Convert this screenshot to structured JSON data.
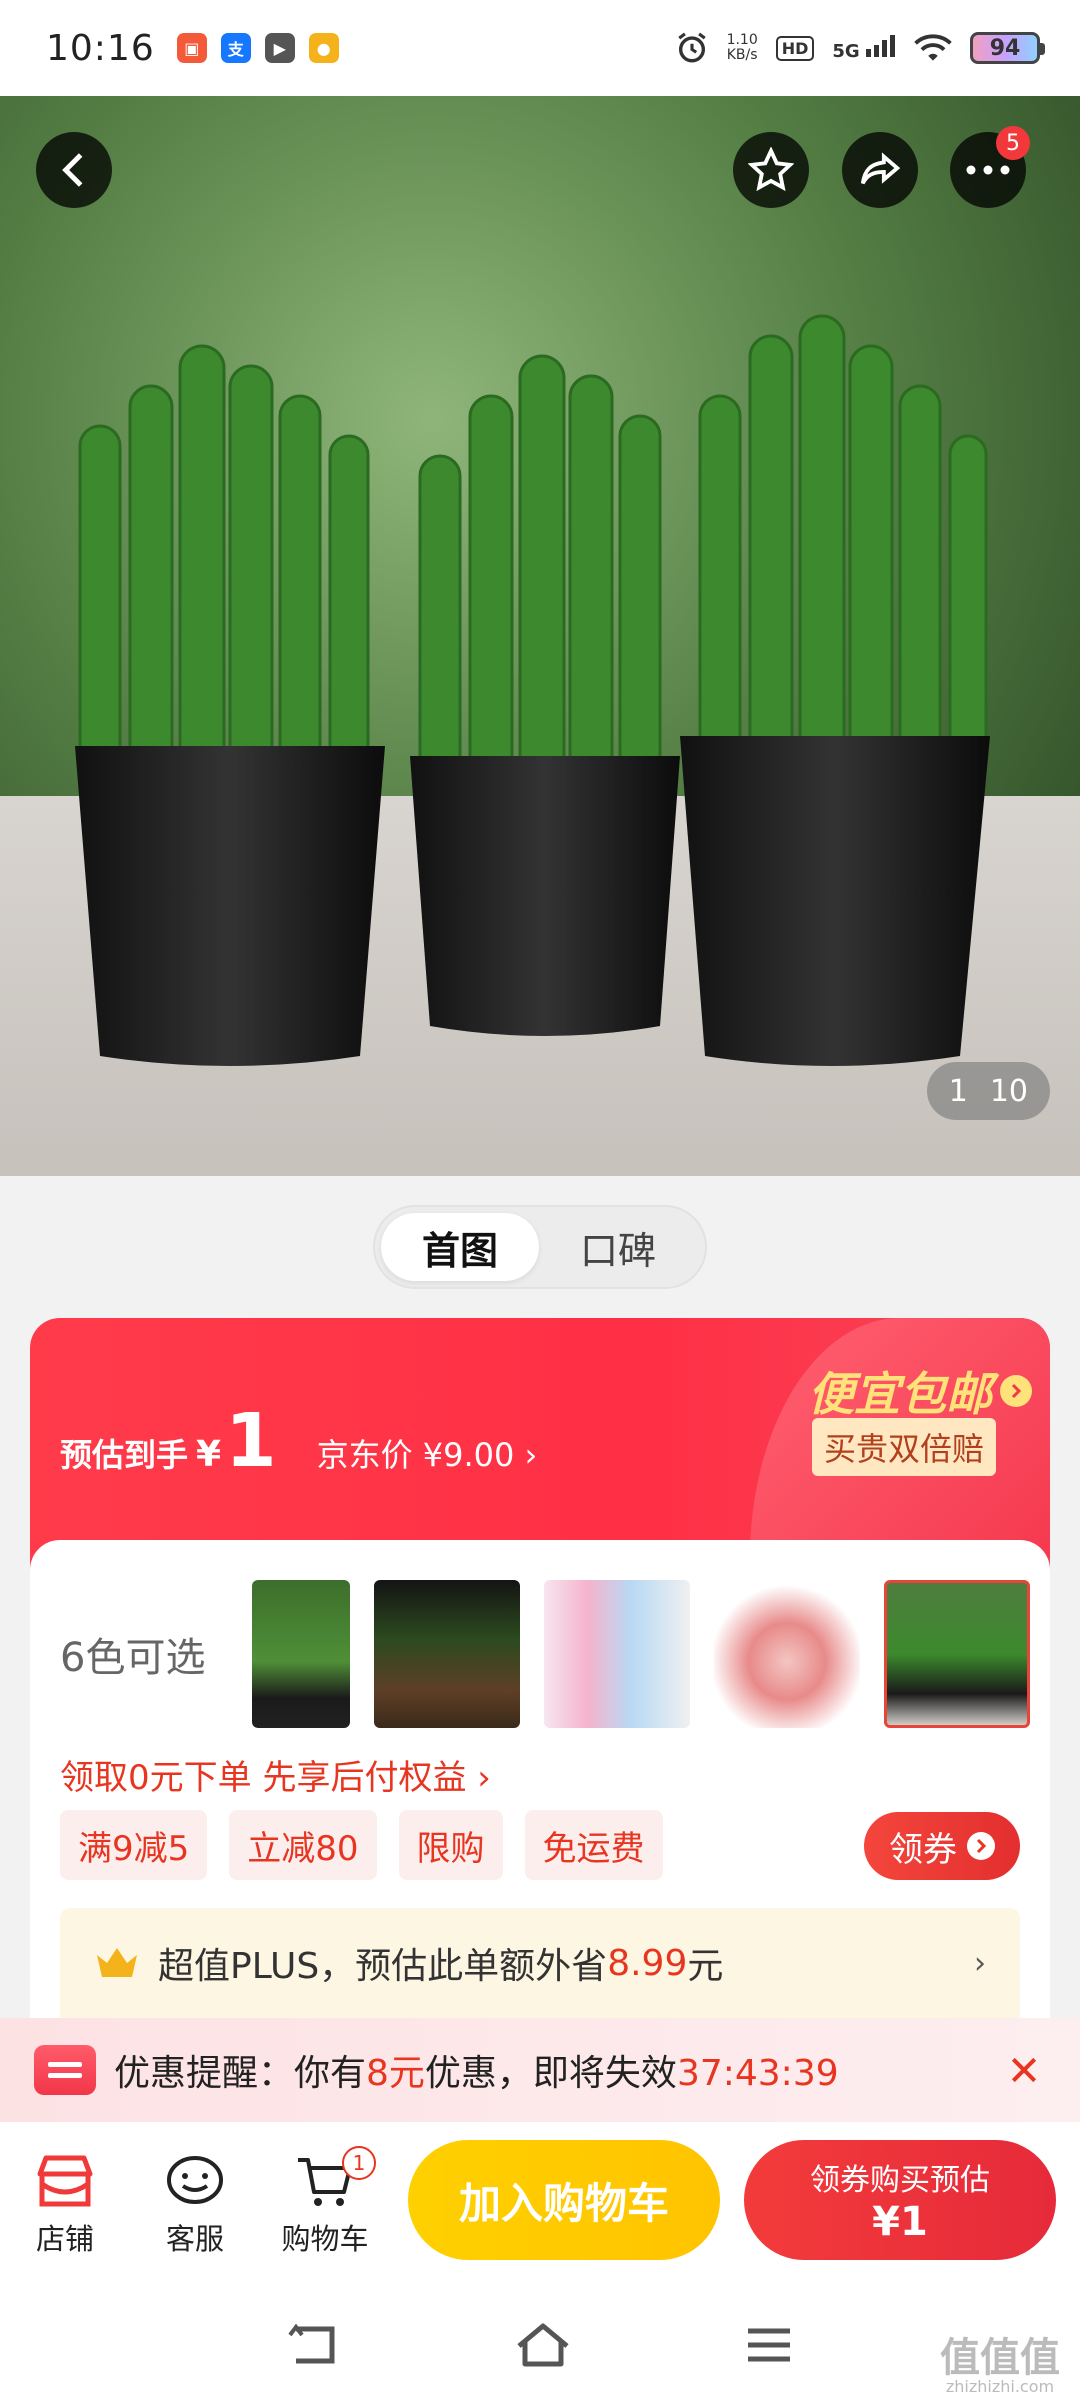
{
  "status_bar": {
    "time": "10:16",
    "speed_value": "1.10",
    "speed_unit": "KB/s",
    "hd": "HD",
    "network": "5G",
    "battery": "94"
  },
  "hero": {
    "counter_current": "1",
    "counter_total": "10",
    "more_badge": "5"
  },
  "tabs": [
    "首图",
    "口碑"
  ],
  "price": {
    "label": "预估到手",
    "currency": "¥",
    "amount": "1",
    "jd_price": "京东价 ¥9.00 ›",
    "promo_title": "便宜包邮",
    "promo_tag": "买贵双倍赔"
  },
  "variants": {
    "label": "6色可选"
  },
  "promo_line": "领取0元下单 先享后付权益 ›",
  "chips": [
    "满9减5",
    "立减80",
    "限购",
    "免运费"
  ],
  "coupon_button": "领券",
  "plus_bar": {
    "text_before": "超值PLUS，预估此单额外省",
    "amount": "8.99",
    "text_after": "元",
    "arrow": "›"
  },
  "notice": {
    "prefix": "优惠提醒：你有",
    "amount": "8元",
    "middle": "优惠，即将失效",
    "countdown": "37:43:39"
  },
  "action_bar": {
    "store": "店铺",
    "service": "客服",
    "cart": "购物车",
    "cart_badge": "1",
    "add_cart": "加入购物车",
    "buy_line1": "领券购买预估",
    "buy_line2": "¥1"
  },
  "watermark": {
    "main": "值值值",
    "sub": "zhizhizhi.com"
  },
  "colors": {
    "accent_red": "#e8351f",
    "cart_yellow": "#ffc400",
    "plus_bg": "#fdf6e3"
  }
}
